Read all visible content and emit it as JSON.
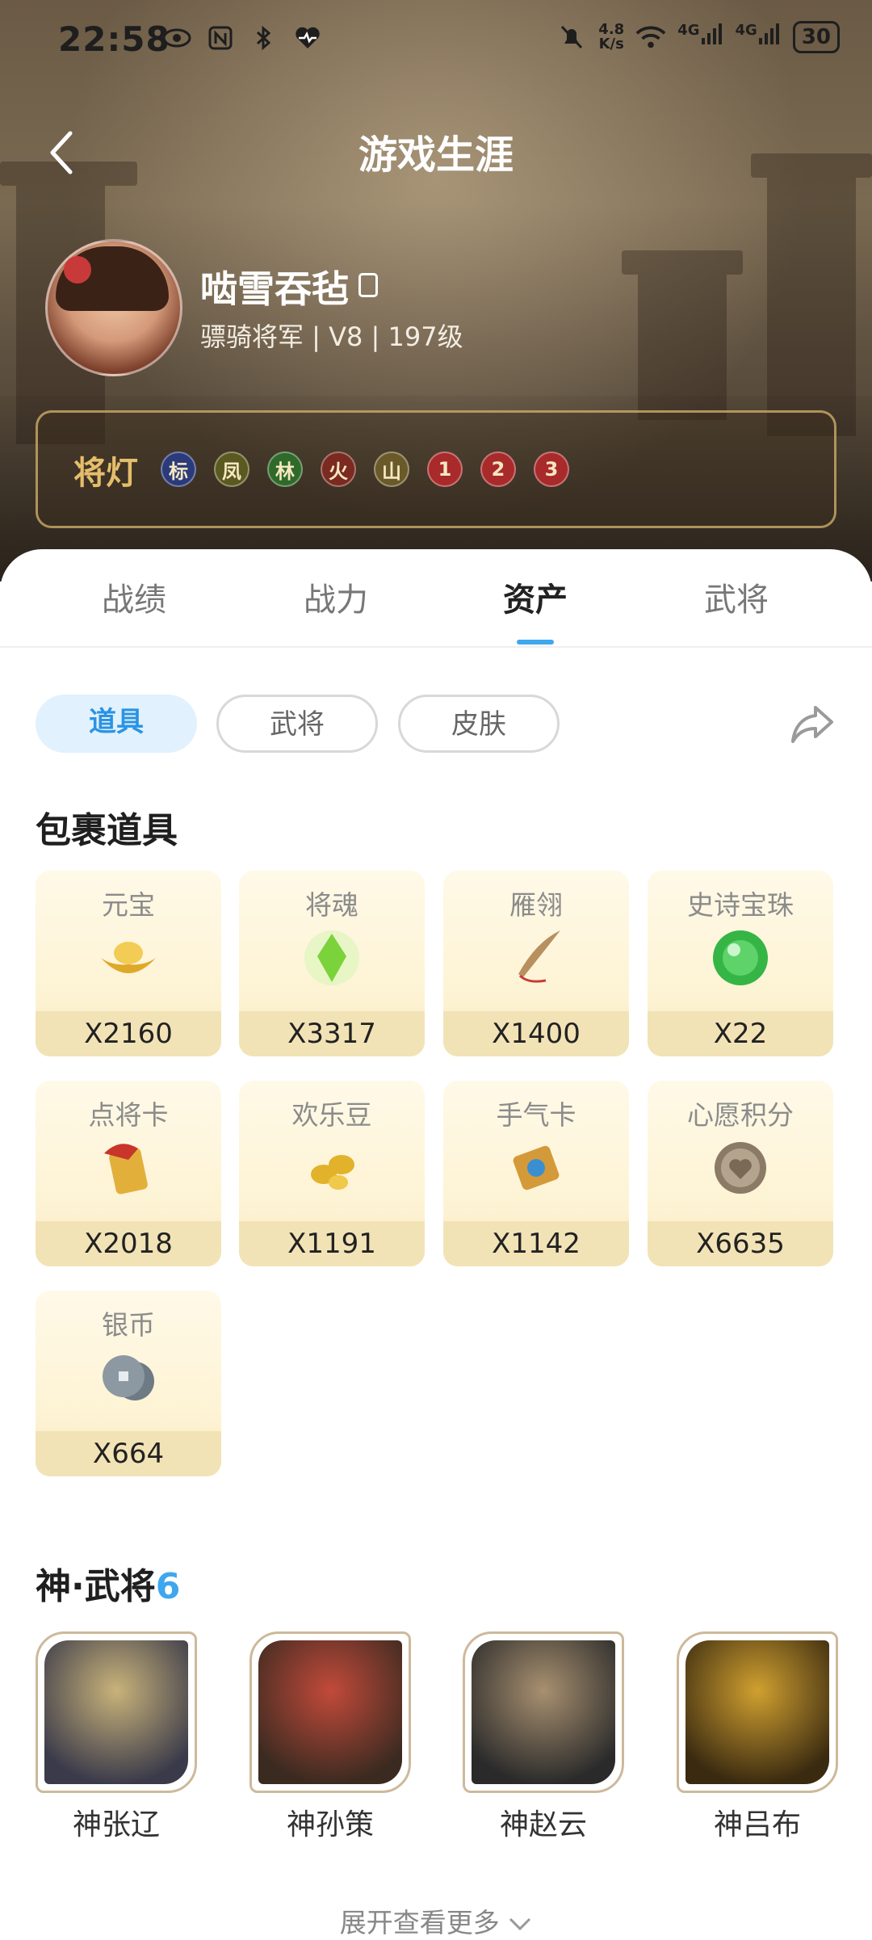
{
  "status": {
    "time": "22:58",
    "speed_top": "4.8",
    "speed_bottom": "K/s",
    "net1": "4G",
    "net2": "4G",
    "battery": "30"
  },
  "header": {
    "title": "游戏生涯"
  },
  "profile": {
    "username": "啮雪吞毡",
    "info": "骠骑将军 | V8 | 197级"
  },
  "lamps": {
    "label": "将灯",
    "items": [
      {
        "glyph": "标",
        "color": "#2a3a7a"
      },
      {
        "glyph": "凤",
        "color": "#5a5a20"
      },
      {
        "glyph": "林",
        "color": "#2f6a2a"
      },
      {
        "glyph": "火",
        "color": "#7a2a20"
      },
      {
        "glyph": "山",
        "color": "#6a5a2a"
      },
      {
        "glyph": "1",
        "color": "#a82a2a"
      },
      {
        "glyph": "2",
        "color": "#a82a2a"
      },
      {
        "glyph": "3",
        "color": "#a82a2a"
      }
    ]
  },
  "tabs": [
    "战绩",
    "战力",
    "资产",
    "武将"
  ],
  "chips": [
    "道具",
    "武将",
    "皮肤"
  ],
  "bag": {
    "title": "包裹道具",
    "items": [
      {
        "name": "元宝",
        "qty": "X2160",
        "icon": "gold-ingot-icon",
        "color": "#e0a82a"
      },
      {
        "name": "将魂",
        "qty": "X3317",
        "icon": "green-crystal-icon",
        "color": "#7ad33a"
      },
      {
        "name": "雁翎",
        "qty": "X1400",
        "icon": "feather-icon",
        "color": "#b89060"
      },
      {
        "name": "史诗宝珠",
        "qty": "X22",
        "icon": "green-orb-icon",
        "color": "#35b545"
      },
      {
        "name": "点将卡",
        "qty": "X2018",
        "icon": "general-card-icon",
        "color": "#c8352a"
      },
      {
        "name": "欢乐豆",
        "qty": "X1191",
        "icon": "beans-icon",
        "color": "#e2b22a"
      },
      {
        "name": "手气卡",
        "qty": "X1142",
        "icon": "luck-card-icon",
        "color": "#3b8fd0"
      },
      {
        "name": "心愿积分",
        "qty": "X6635",
        "icon": "heart-coin-icon",
        "color": "#8a7a66"
      },
      {
        "name": "银币",
        "qty": "X664",
        "icon": "silver-coin-icon",
        "color": "#8c98a2"
      }
    ]
  },
  "gods": {
    "title": "神·武将",
    "count": "6",
    "heroes": [
      {
        "name": "神张辽",
        "color1": "#c9b37a",
        "color2": "#3a3a4a"
      },
      {
        "name": "神孙策",
        "color1": "#c24a3a",
        "color2": "#3a2a20"
      },
      {
        "name": "神赵云",
        "color1": "#a89070",
        "color2": "#2a2a2a"
      },
      {
        "name": "神吕布",
        "color1": "#d0a030",
        "color2": "#3a2a10"
      }
    ]
  },
  "expand_label": "展开查看更多"
}
